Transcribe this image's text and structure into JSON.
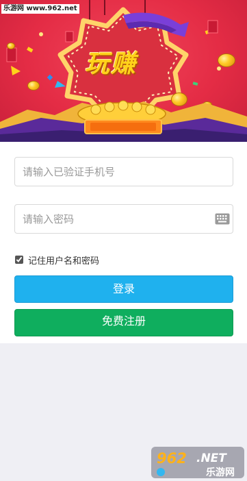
{
  "banner": {
    "title": "玩赚",
    "site_badge": "乐游网 www.962.net"
  },
  "login_form": {
    "phone_placeholder": "请输入已验证手机号",
    "password_placeholder": "请输入密码",
    "remember_label": "记住用户名和密码",
    "remember_checked": true,
    "login_label": "登录",
    "register_label": "免费注册"
  },
  "watermark": {
    "brand": "962.NET",
    "name": "乐游网"
  },
  "colors": {
    "banner_red": "#e42c45",
    "login_blue": "#1fb1ee",
    "register_green": "#0fae5e",
    "page_gray": "#efeff4"
  }
}
